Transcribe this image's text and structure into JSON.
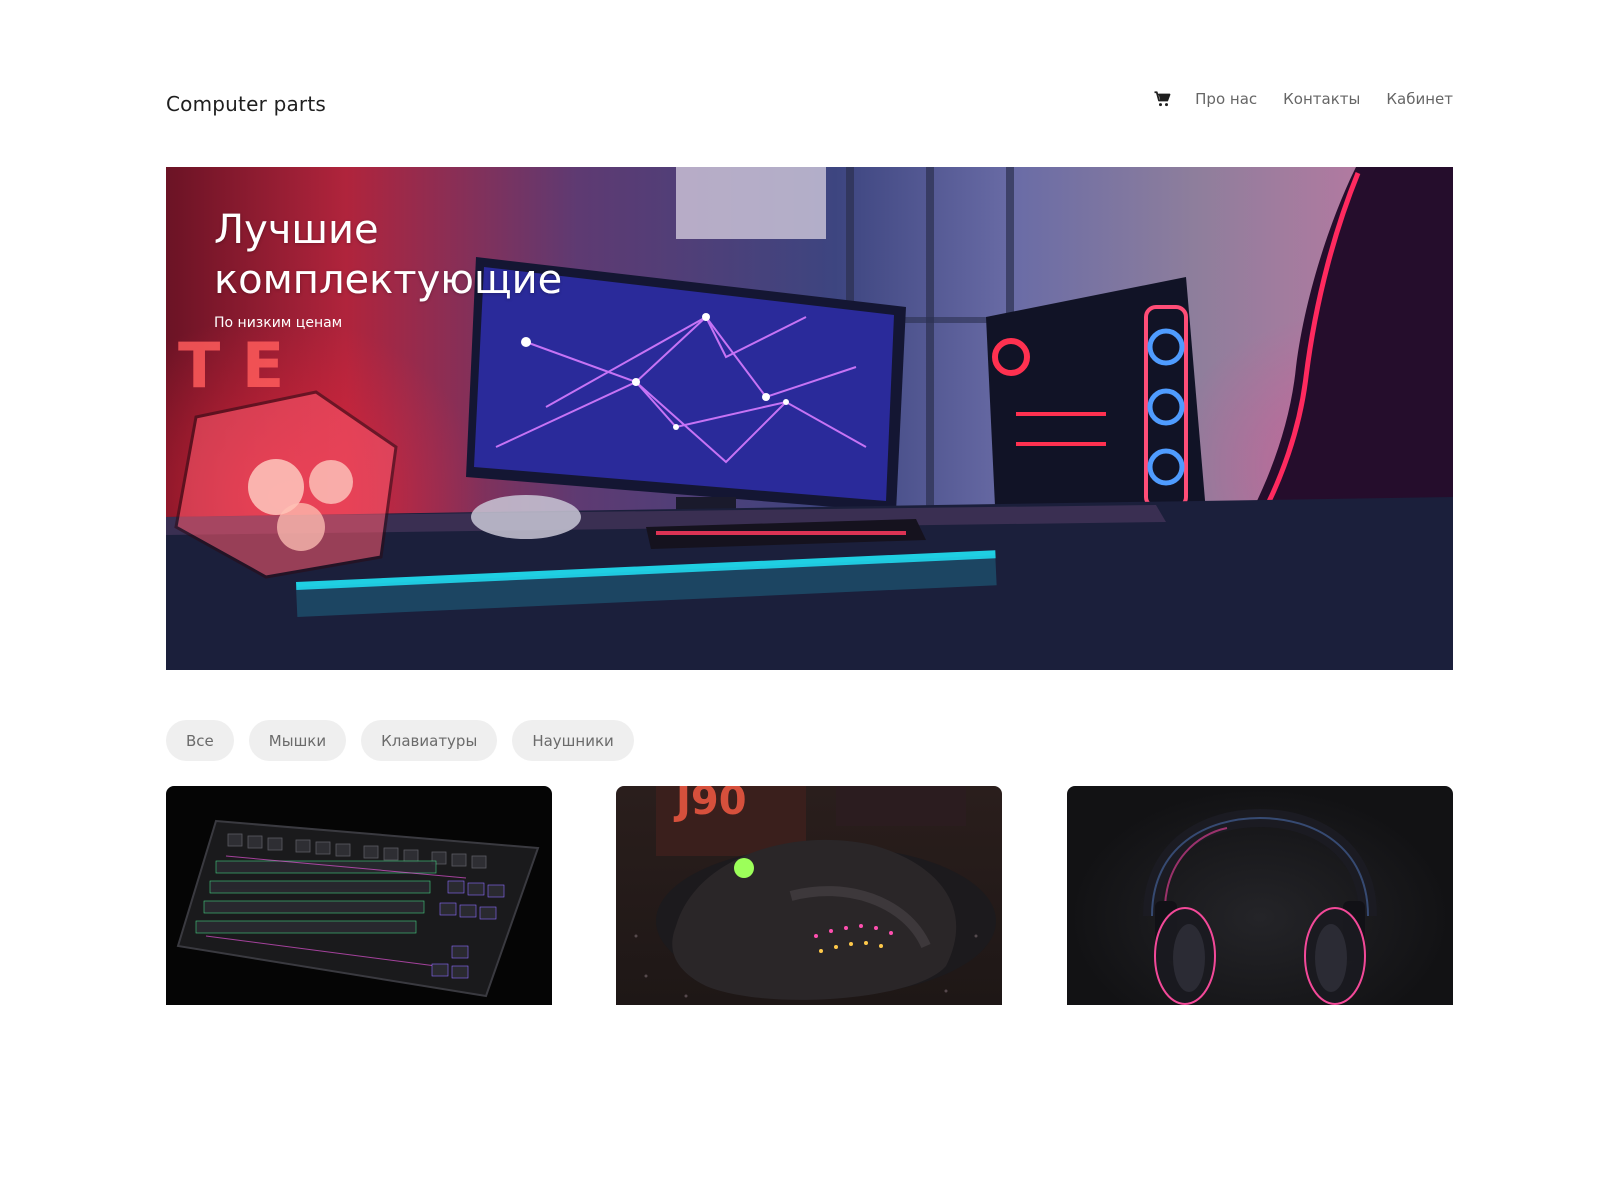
{
  "header": {
    "logo": "Computer parts",
    "cart_icon": "cart-icon",
    "nav": [
      {
        "label": "Про нас"
      },
      {
        "label": "Контакты"
      },
      {
        "label": "Кабинет"
      }
    ]
  },
  "hero": {
    "title": "Лучшие комплектующие",
    "subtitle": "По низким ценам",
    "image": "gaming-setup-photo"
  },
  "filters": [
    {
      "label": "Все"
    },
    {
      "label": "Мышки"
    },
    {
      "label": "Клавиатуры"
    },
    {
      "label": "Наушники"
    }
  ],
  "products": [
    {
      "image": "keyboard-photo"
    },
    {
      "image": "mouse-photo"
    },
    {
      "image": "headphones-photo"
    }
  ]
}
